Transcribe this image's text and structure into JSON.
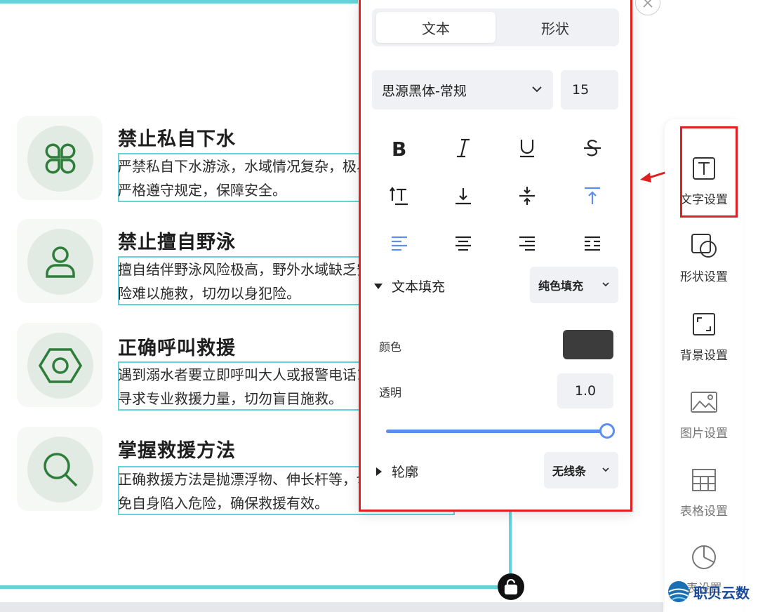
{
  "slide": {
    "items": [
      {
        "title": "禁止私自下水",
        "desc": "严禁私自下水游泳，水域情况复杂，极易发生意外，必须严格遵守规定，保障安全。",
        "icon": "clover-icon"
      },
      {
        "title": "禁止擅自野泳",
        "desc": "擅自结伴野泳风险极高，野外水域缺乏安全保障，一旦遇险难以施救，切勿以身犯险。",
        "icon": "person-icon"
      },
      {
        "title": "正确呼叫救援",
        "desc": "遇到溺水者要立即呼叫大人或报警电话110/120，及时寻求专业救援力量，切勿盲目施救。",
        "icon": "hexagon-nut-icon"
      },
      {
        "title": "掌握救援方法",
        "desc": "正确救援方法是抛漂浮物、伸长杆等，切勿徒手救援，以免自身陷入危险，确保救援有效。",
        "icon": "search-icon"
      }
    ]
  },
  "panel": {
    "tabs": [
      {
        "label": "文本",
        "active": true
      },
      {
        "label": "形状",
        "active": false
      }
    ],
    "font_family": "思源黑体-常规",
    "font_size": "15",
    "text_fill": {
      "label": "文本填充",
      "value": "纯色填充"
    },
    "color_label": "颜色",
    "color_value": "#3c3c3c",
    "opacity_label": "透明",
    "opacity_value": "1.0",
    "opacity": 1.0,
    "outline": {
      "label": "轮廓",
      "value": "无线条"
    }
  },
  "sidebar": {
    "items": [
      {
        "label": "文字设置",
        "icon": "text-settings-icon",
        "active": true
      },
      {
        "label": "形状设置",
        "icon": "shape-settings-icon",
        "active": false
      },
      {
        "label": "背景设置",
        "icon": "background-settings-icon",
        "active": false
      },
      {
        "label": "图片设置",
        "icon": "image-settings-icon",
        "active": false
      },
      {
        "label": "表格设置",
        "icon": "table-settings-icon",
        "active": false
      },
      {
        "label": "表设置",
        "icon": "chart-settings-icon",
        "active": false
      }
    ]
  },
  "watermark": {
    "text": "职贝云数"
  },
  "colors": {
    "accent": "#5b8ef0",
    "selection": "#64d3dc",
    "highlight": "#e02020",
    "icon_green": "#2e7d3a"
  }
}
